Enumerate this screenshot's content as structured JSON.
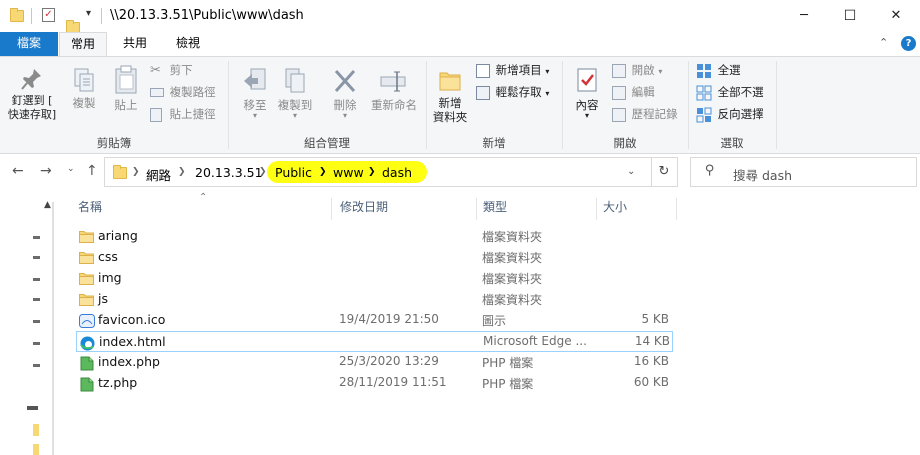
{
  "window": {
    "title": "\\\\20.13.3.51\\Public\\www\\dash",
    "minimize": "─",
    "maximize": "☐",
    "close": "✕"
  },
  "tabs": {
    "file": "檔案",
    "home": "常用",
    "share": "共用",
    "view": "檢視"
  },
  "ribbon": {
    "clipboard": {
      "label": "剪貼簿",
      "pin": "釘選到 [\n快速存取]",
      "copy": "複製",
      "paste": "貼上",
      "cut": "剪下",
      "copy_path": "複製路徑",
      "paste_shortcut": "貼上捷徑"
    },
    "organize": {
      "label": "組合管理",
      "move_to": "移至",
      "copy_to": "複製到",
      "delete": "刪除",
      "rename": "重新命名"
    },
    "new": {
      "label": "新增",
      "new_folder": "新增\n資料夾",
      "new_item": "新增項目",
      "easy_access": "輕鬆存取"
    },
    "open": {
      "label": "開啟",
      "properties": "內容",
      "open": "開啟",
      "edit": "編輯",
      "history": "歷程記錄"
    },
    "select": {
      "label": "選取",
      "select_all": "全選",
      "select_none": "全部不選",
      "invert": "反向選擇"
    }
  },
  "address": {
    "crumbs": [
      "網路",
      "20.13.3.51",
      "Public",
      "www",
      "dash"
    ],
    "search_placeholder": "搜尋 dash"
  },
  "columns": {
    "name": "名稱",
    "date": "修改日期",
    "type": "類型",
    "size": "大小"
  },
  "files": [
    {
      "name": "ariang",
      "date": "",
      "type": "檔案資料夾",
      "size": "",
      "icon": "folder-icon"
    },
    {
      "name": "css",
      "date": "",
      "type": "檔案資料夾",
      "size": "",
      "icon": "folder-icon"
    },
    {
      "name": "img",
      "date": "",
      "type": "檔案資料夾",
      "size": "",
      "icon": "folder-icon"
    },
    {
      "name": "js",
      "date": "",
      "type": "檔案資料夾",
      "size": "",
      "icon": "folder-icon"
    },
    {
      "name": "favicon.ico",
      "date": "19/4/2019 21:50",
      "type": "圖示",
      "size": "5 KB",
      "icon": "image-file-icon"
    },
    {
      "name": "index.html",
      "date": "",
      "type": "Microsoft Edge ...",
      "size": "14 KB",
      "icon": "edge-icon"
    },
    {
      "name": "index.php",
      "date": "25/3/2020 13:29",
      "type": "PHP 檔案",
      "size": "16 KB",
      "icon": "php-file-icon"
    },
    {
      "name": "tz.php",
      "date": "28/11/2019 11:51",
      "type": "PHP 檔案",
      "size": "60 KB",
      "icon": "php-file-icon"
    }
  ],
  "colors": {
    "accent": "#1979ca",
    "highlight": "#ffff14",
    "selection_border": "#99d1ff"
  }
}
